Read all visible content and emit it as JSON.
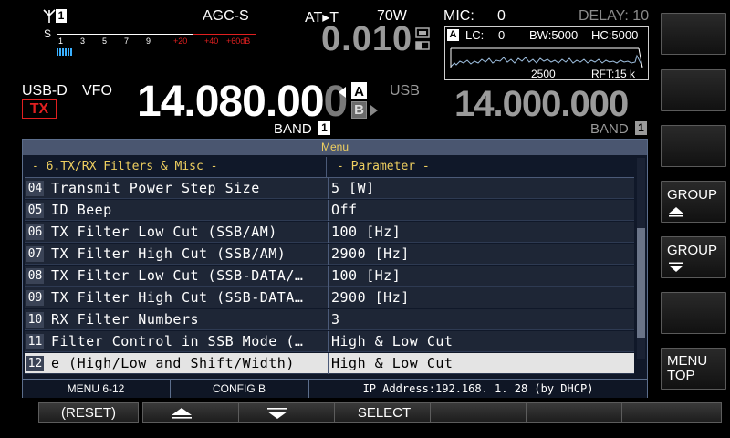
{
  "status": {
    "agc": "AGC-S",
    "at": "AT▸T",
    "power": "70W",
    "mic_label": "MIC:",
    "mic_value": "0",
    "delay": "DELAY: 10",
    "offset_readout": "0.010",
    "ant_number": "1"
  },
  "meter": {
    "s_label": "S",
    "scale": [
      "1",
      "3",
      "5",
      "7",
      "9"
    ],
    "scale_red": [
      "+20",
      "+40",
      "+60dB"
    ]
  },
  "scope": {
    "a_label": "A",
    "lc": "LC:",
    "lc_value": "0",
    "bw": "BW:5000",
    "hc": "HC:5000",
    "freq_mark": "2500",
    "rft": "RFT:15 k"
  },
  "vfo_a": {
    "mode": "USB-D",
    "vfo": "VFO",
    "tx": "TX",
    "freq": "14.080.00",
    "freq_last": "0",
    "a_label": "A",
    "b_label": "B",
    "band_label": "BAND",
    "band_num": "1"
  },
  "vfo_b": {
    "mode": "USB",
    "freq": "14.000.000",
    "band_label": "BAND",
    "band_num": "1"
  },
  "menu": {
    "title": "Menu",
    "group_header": "- 6.TX/RX Filters & Misc -",
    "param_header": "- Parameter -",
    "rows": [
      {
        "num": "04",
        "name": "Transmit Power Step Size",
        "value": "5 [W]"
      },
      {
        "num": "05",
        "name": "ID Beep",
        "value": "Off"
      },
      {
        "num": "06",
        "name": "TX Filter Low Cut (SSB/AM)",
        "value": "100 [Hz]"
      },
      {
        "num": "07",
        "name": "TX Filter High Cut (SSB/AM)",
        "value": "2900 [Hz]"
      },
      {
        "num": "08",
        "name": "TX Filter Low Cut (SSB-DATA/…",
        "value": "100 [Hz]"
      },
      {
        "num": "09",
        "name": "TX Filter High Cut (SSB-DATA…",
        "value": "2900 [Hz]"
      },
      {
        "num": "10",
        "name": "RX Filter Numbers",
        "value": "3"
      },
      {
        "num": "11",
        "name": "Filter Control in SSB Mode (…",
        "value": "High & Low Cut"
      },
      {
        "num": "12",
        "name": "e (High/Low and Shift/Width)",
        "value": "High & Low Cut"
      }
    ],
    "status_menu": "MENU 6-12",
    "status_config": "CONFIG B",
    "status_ip": "IP Address:192.168.  1. 28 (by DHCP)"
  },
  "softkeys": {
    "group_up": "GROUP",
    "group_down": "GROUP",
    "menu_top_1": "MENU",
    "menu_top_2": "TOP"
  },
  "bottom_keys": {
    "reset": "(RESET)",
    "select": "SELECT"
  },
  "colors": {
    "accent_yellow": "#f0d060",
    "tx_red": "#e02020",
    "menu_bg": "#101829",
    "selected_row": "#e4e4e4"
  }
}
